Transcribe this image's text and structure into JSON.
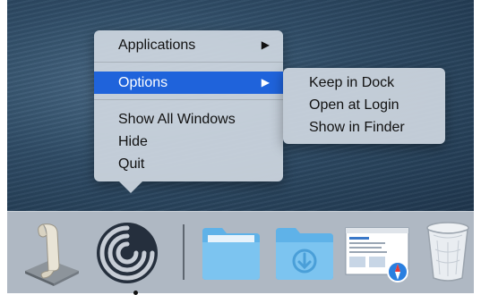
{
  "context_menu": {
    "items": [
      {
        "label": "Applications",
        "submenu_arrow": "▶"
      },
      {
        "label": "Options",
        "submenu_arrow": "▶"
      },
      {
        "label": "Show All Windows"
      },
      {
        "label": "Hide"
      },
      {
        "label": "Quit"
      }
    ],
    "selected_item": "Options",
    "selection_color": "#1f63db"
  },
  "submenu": {
    "items": [
      {
        "label": "Keep in Dock"
      },
      {
        "label": "Open at Login"
      },
      {
        "label": "Show in Finder"
      }
    ]
  },
  "dock": {
    "items": [
      {
        "icon": "script-editor-icon"
      },
      {
        "icon": "app-spiral-icon",
        "running": true
      },
      {
        "icon": "folder-icon"
      },
      {
        "icon": "downloads-folder-icon"
      },
      {
        "icon": "safari-document-icon"
      },
      {
        "icon": "trash-icon"
      }
    ]
  }
}
